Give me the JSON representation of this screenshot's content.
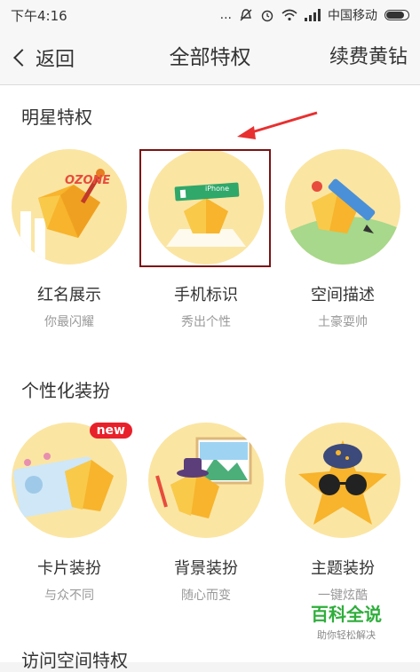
{
  "status_bar": {
    "time": "下午4:16",
    "dots": "...",
    "carrier": "中国移动"
  },
  "nav": {
    "back_label": "返回",
    "title": "全部特权",
    "renew_label": "续费黄钻"
  },
  "sections": [
    {
      "title": "明星特权",
      "items": [
        {
          "name": "红名展示",
          "desc": "你最闪耀"
        },
        {
          "name": "手机标识",
          "desc": "秀出个性"
        },
        {
          "name": "空间描述",
          "desc": "土豪耍帅"
        }
      ]
    },
    {
      "title": "个性化装扮",
      "items": [
        {
          "name": "卡片装扮",
          "desc": "与众不同",
          "badge": "new"
        },
        {
          "name": "背景装扮",
          "desc": "随心而变"
        },
        {
          "name": "主题装扮",
          "desc": "一键炫酷"
        }
      ]
    },
    {
      "title": "访问空间特权"
    }
  ],
  "illustrations": {
    "ozone_text": "OZONE",
    "phone_tag": "iPhone"
  },
  "watermark": {
    "title": "百科全说",
    "subtitle": "助你轻松解决"
  },
  "colors": {
    "circle_bg": "#fbe5a3",
    "gem": "#f7b42c",
    "badge": "#e8202a",
    "highlight": "#7a1212",
    "arrow": "#e83030",
    "watermark": "#2fae3c"
  }
}
